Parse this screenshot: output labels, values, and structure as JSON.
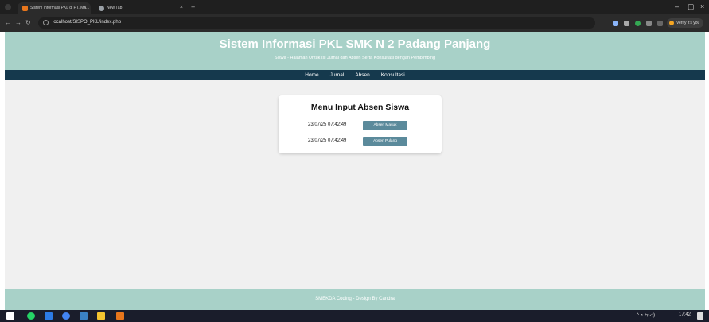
{
  "browser": {
    "tabs": [
      {
        "title": "Sistem Informasi PKL di PT. Ma...",
        "active": true
      },
      {
        "title": "New Tab",
        "active": false
      }
    ],
    "url": "localhost/SISPO_PKL/index.php",
    "profile_label": "Verify it's you"
  },
  "header": {
    "title": "Sistem Informasi PKL SMK N 2 Padang Panjang",
    "subtitle": "Siswa - Halaman Untuk Isi Jurnal dan Absen Serta Konsultasi dengan Pembimbing"
  },
  "nav": {
    "items": [
      "Home",
      "Jurnal",
      "Absen",
      "Konsultasi"
    ]
  },
  "card": {
    "title": "Menu Input Absen Siswa",
    "rows": [
      {
        "time": "23/07/25 07:42:49",
        "button": "Absen Masuk"
      },
      {
        "time": "23/07/25 07:42:49",
        "button": "Absen Pulang"
      }
    ]
  },
  "footer": {
    "text": "SMEKDA Coding - Design By Candra"
  },
  "taskbar": {
    "clock_time": "17:42"
  },
  "colors": {
    "header_bg": "#a8d1c8",
    "navbar_bg": "#15394d",
    "button_bg": "#5b8a9b",
    "page_bg": "#f0f0f0"
  }
}
